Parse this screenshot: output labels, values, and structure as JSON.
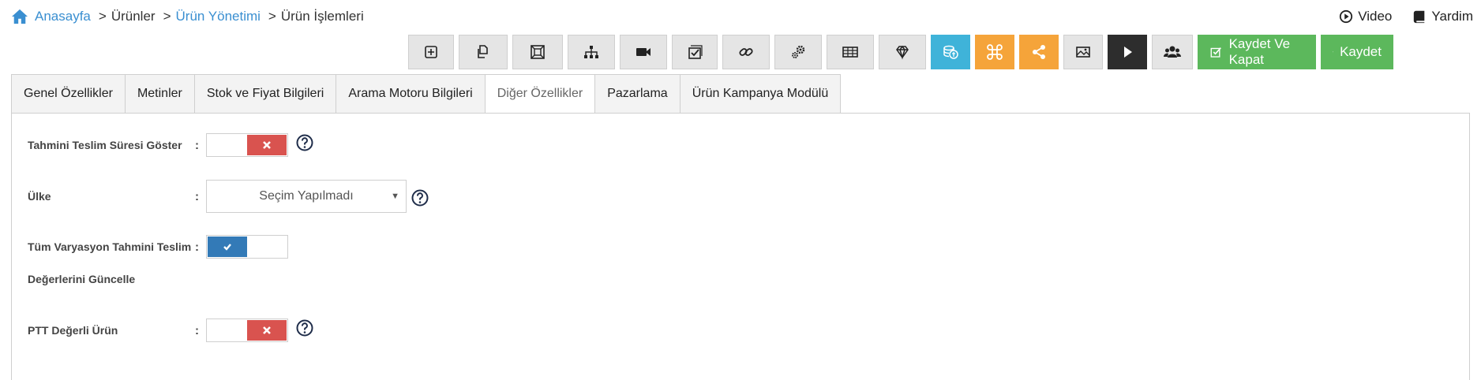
{
  "breadcrumb": {
    "home": "Anasayfa",
    "items": [
      {
        "label": "Ürünler",
        "link": false
      },
      {
        "label": "Ürün Yönetimi",
        "link": true
      },
      {
        "label": "Ürün İşlemleri",
        "link": false
      }
    ],
    "separator": ">"
  },
  "top_links": {
    "video": "Video",
    "help": "Yardim"
  },
  "toolbar": {
    "icons": [
      "plus-square-icon",
      "copy-icon",
      "resize-icon",
      "sitemap-icon",
      "video-camera-icon",
      "checklist-icon",
      "link-icon",
      "gears-icon",
      "table-icon",
      "diamond-icon",
      "coins-icon",
      "command-icon",
      "share-icon",
      "image-icon",
      "play-icon",
      "users-icon"
    ],
    "save_close": "Kaydet Ve Kapat",
    "save": "Kaydet",
    "colors": {
      "blue": "#3fb3d9",
      "orange": "#f5a43a",
      "dark": "#2d2d2d",
      "green": "#5cb85c"
    }
  },
  "tabs": [
    {
      "label": "Genel Özellikler",
      "active": false
    },
    {
      "label": "Metinler",
      "active": false
    },
    {
      "label": "Stok ve Fiyat Bilgileri",
      "active": false
    },
    {
      "label": "Arama Motoru Bilgileri",
      "active": false
    },
    {
      "label": "Diğer Özellikler",
      "active": true
    },
    {
      "label": "Pazarlama",
      "active": false
    },
    {
      "label": "Ürün Kampanya Modülü",
      "active": false
    }
  ],
  "form": {
    "colon": ":",
    "delivery_time": {
      "label": "Tahmini Teslim Süresi Göster",
      "enabled": false
    },
    "country": {
      "label": "Ülke",
      "selected": "Seçim Yapılmadı"
    },
    "variation_update": {
      "label_line1": "Tüm Varyasyon Tahmini Teslim",
      "label_line2": "Değerlerini Güncelle",
      "enabled": true
    },
    "ptt": {
      "label": "PTT Değerli Ürün",
      "enabled": false
    }
  }
}
